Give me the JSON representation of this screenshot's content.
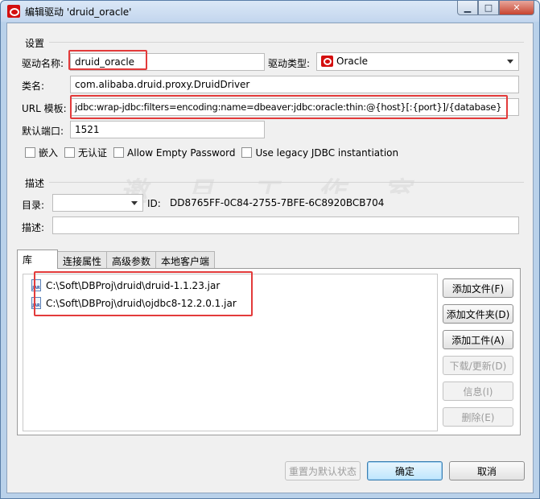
{
  "window": {
    "title": "编辑驱动 'druid_oracle'"
  },
  "settings": {
    "group_label": "设置",
    "driver_name_label": "驱动名称:",
    "driver_name_value": "druid_oracle",
    "driver_type_label": "驱动类型:",
    "driver_type_value": "Oracle",
    "class_name_label": "类名:",
    "class_name_value": "com.alibaba.druid.proxy.DruidDriver",
    "url_template_label": "URL 模板:",
    "url_template_value": "jdbc:wrap-jdbc:filters=encoding:name=dbeaver:jdbc:oracle:thin:@{host}[:{port}]/{database}",
    "default_port_label": "默认端口:",
    "default_port_value": "1521",
    "checkboxes": [
      "嵌入",
      "无认证",
      "Allow Empty Password",
      "Use legacy JDBC instantiation"
    ]
  },
  "description": {
    "group_label": "描述",
    "category_label": "目录:",
    "id_label": "ID:",
    "id_value": "DD8765FF-0C84-2755-7BFE-6C8920BCB704",
    "description_label": "描述:"
  },
  "tabs": [
    "库",
    "连接属性",
    "高级参数",
    "本地客户端"
  ],
  "libraries": {
    "files": [
      "C:\\Soft\\DBProj\\druid\\druid-1.1.23.jar",
      "C:\\Soft\\DBProj\\druid\\ojdbc8-12.2.0.1.jar"
    ],
    "buttons": {
      "add_file": "添加文件(F)",
      "add_folder": "添加文件夹(D)",
      "add_artifact": "添加工件(A)",
      "download_update": "下载/更新(D)",
      "info": "信息(I)",
      "delete": "删除(E)"
    }
  },
  "footer": {
    "reset": "重置为默认状态",
    "ok": "确定",
    "cancel": "取消"
  },
  "icons": {
    "app": "oracle-icon",
    "jar": "jar-file-icon"
  },
  "colors": {
    "highlight": "#e33b3b",
    "oracle_red": "#d40f0f"
  }
}
